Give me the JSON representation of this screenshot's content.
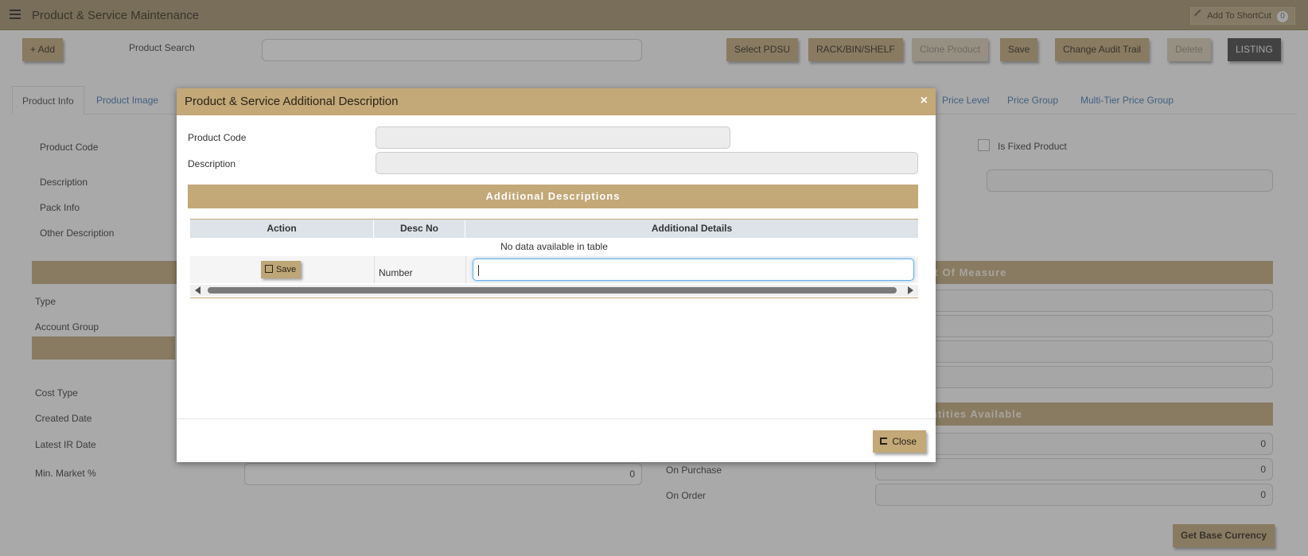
{
  "topbar": {
    "title": "Product & Service Maintenance",
    "shortcut_label": "Add To ShortCut",
    "shortcut_count": "0"
  },
  "toolbar": {
    "add_label": "+ Add",
    "search_label": "Product Search",
    "buttons": [
      "Select PDSU",
      "RACK/BIN/SHELF",
      "Clone Product",
      "Save",
      "Change Audit Trail",
      "Delete",
      "LISTING"
    ]
  },
  "tabs": [
    "Product Info",
    "Product Image",
    "Price Level",
    "Price Group",
    "Multi-Tier Price Group"
  ],
  "form": {
    "product_code": "Product Code",
    "description": "Description",
    "pack_info": "Pack Info",
    "other_description": "Other Description",
    "is_fixed_product": "Is Fixed Product",
    "type": "Type",
    "account_group": "Account Group",
    "cost_type": "Cost Type",
    "created_date": "Created Date",
    "latest_ir_date": "Latest IR Date",
    "min_market": "Min. Market %",
    "min_market_value": "0",
    "on_purchase": "On Purchase",
    "on_order": "On Order",
    "qty_values": [
      "0",
      "0",
      "0"
    ],
    "section_uom": "it Of Measure",
    "section_qty": "ntities Available",
    "get_base_currency": "Get Base Currency"
  },
  "modal": {
    "title": "Product & Service Additional Description",
    "close_x": "×",
    "product_code_label": "Product Code",
    "description_label": "Description",
    "section_title": "Additional Descriptions",
    "columns": [
      "Action",
      "Desc No",
      "Additional Details"
    ],
    "empty_text": "No data available in table",
    "row_save": "Save",
    "row_descno": "Number",
    "close_label": "Close"
  }
}
